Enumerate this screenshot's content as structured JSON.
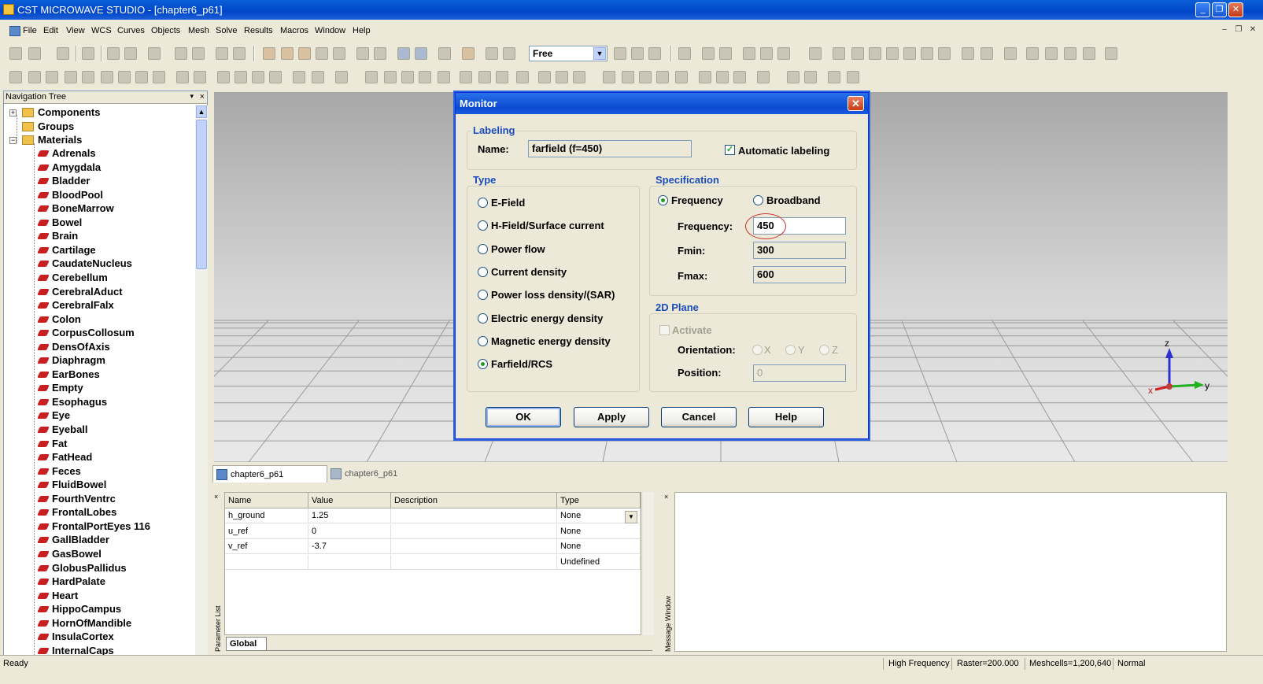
{
  "app": {
    "title": "CST MICROWAVE STUDIO - [chapter6_p61]",
    "window_buttons": [
      "_",
      "❐",
      "✕"
    ]
  },
  "menu": {
    "items": [
      "File",
      "Edit",
      "View",
      "WCS",
      "Curves",
      "Objects",
      "Mesh",
      "Solve",
      "Results",
      "Macros",
      "Window",
      "Help"
    ],
    "mdi_buttons": [
      "–",
      "❐",
      "✕"
    ]
  },
  "toolbar": {
    "selection_mode": "Free"
  },
  "nav_tree": {
    "title": "Navigation Tree",
    "close": "×",
    "roots": [
      {
        "label": "Components",
        "expander": "+"
      },
      {
        "label": "Groups",
        "expander": ""
      },
      {
        "label": "Materials",
        "expander": "−"
      }
    ],
    "materials": [
      "Adrenals",
      "Amygdala",
      "Bladder",
      "BloodPool",
      "BoneMarrow",
      "Bowel",
      "Brain",
      "Cartilage",
      "CaudateNucleus",
      "Cerebellum",
      "CerebralAduct",
      "CerebralFalx",
      "Colon",
      "CorpusCollosum",
      "DensOfAxis",
      "Diaphragm",
      "EarBones",
      "Empty",
      "Esophagus",
      "Eye",
      "Eyeball",
      "Fat",
      "FatHead",
      "Feces",
      "FluidBowel",
      "FourthVentrc",
      "FrontalLobes",
      "FrontalPortEyes 116",
      "GallBladder",
      "GasBowel",
      "GlobusPallidus",
      "HardPalate",
      "Heart",
      "HippoCampus",
      "HornOfMandible",
      "InsulaCortex",
      "InternalCaps"
    ]
  },
  "viewport": {
    "axes": {
      "x": "x",
      "y": "y",
      "z": "z"
    }
  },
  "doc_tabs": [
    "chapter6_p61",
    "chapter6_p61"
  ],
  "parameter_list": {
    "panel_label": "Parameter List",
    "columns": [
      "Name",
      "Value",
      "Description",
      "Type"
    ],
    "rows": [
      [
        "h_ground",
        "1.25",
        "",
        "None"
      ],
      [
        "u_ref",
        "0",
        "",
        "None"
      ],
      [
        "v_ref",
        "-3.7",
        "",
        "None"
      ],
      [
        "",
        "",
        "",
        "Undefined"
      ]
    ],
    "tab": "Global"
  },
  "message_window": {
    "panel_label": "Message Window"
  },
  "status": {
    "ready": "Ready",
    "mode": "High Frequency",
    "raster": "Raster=200.000",
    "meshcells": "Meshcells=1,200,640",
    "normal": "Normal"
  },
  "dialog": {
    "title": "Monitor",
    "labeling": {
      "group_title": "Labeling",
      "name_label": "Name:",
      "name_value": "farfield (f=450)",
      "auto_label": "Automatic labeling",
      "auto_checked": true
    },
    "type": {
      "group_title": "Type",
      "options": [
        "E-Field",
        "H-Field/Surface current",
        "Power flow",
        "Current density",
        "Power loss density/(SAR)",
        "Electric energy density",
        "Magnetic energy density",
        "Farfield/RCS"
      ],
      "selected": "Farfield/RCS"
    },
    "specification": {
      "group_title": "Specification",
      "mode_frequency": "Frequency",
      "mode_broadband": "Broadband",
      "frequency_label": "Frequency:",
      "frequency_value": "450",
      "fmin_label": "Fmin:",
      "fmin_value": "300",
      "fmax_label": "Fmax:",
      "fmax_value": "600"
    },
    "plane2d": {
      "group_title": "2D Plane",
      "activate_label": "Activate",
      "orientation_label": "Orientation:",
      "orient_x": "X",
      "orient_y": "Y",
      "orient_z": "Z",
      "position_label": "Position:",
      "position_value": "0"
    },
    "buttons": {
      "ok": "OK",
      "apply": "Apply",
      "cancel": "Cancel",
      "help": "Help"
    }
  },
  "colors": {
    "title_bar": "#0046c8",
    "group_title": "#1a4cbc",
    "material_icon": "#c82020",
    "highlight_circle": "#d03030"
  }
}
